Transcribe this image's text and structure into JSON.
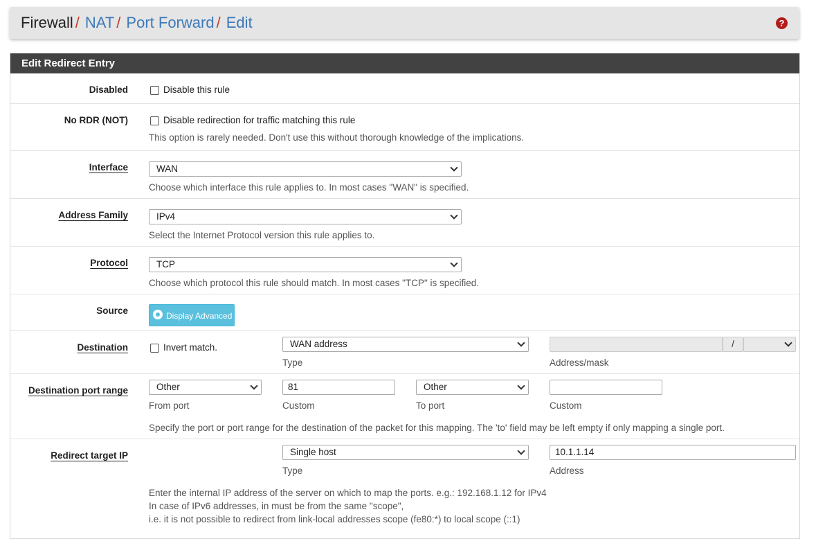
{
  "breadcrumb": {
    "items": [
      "Firewall",
      "NAT",
      "Port Forward",
      "Edit"
    ],
    "separator": "/"
  },
  "help_icon": "?",
  "panel": {
    "title": "Edit Redirect Entry"
  },
  "disabled": {
    "label": "Disabled",
    "checkbox_label": "Disable this rule",
    "checked": false
  },
  "nordr": {
    "label": "No RDR (NOT)",
    "checkbox_label": "Disable redirection for traffic matching this rule",
    "help": "This option is rarely needed. Don't use this without thorough knowledge of the implications.",
    "checked": false
  },
  "interface": {
    "label": "Interface",
    "value": "WAN",
    "help": "Choose which interface this rule applies to. In most cases \"WAN\" is specified."
  },
  "address_family": {
    "label": "Address Family",
    "value": "IPv4",
    "help": "Select the Internet Protocol version this rule applies to."
  },
  "protocol": {
    "label": "Protocol",
    "value": "TCP",
    "help": "Choose which protocol this rule should match. In most cases \"TCP\" is specified."
  },
  "source": {
    "label": "Source",
    "button_label": "Display Advanced"
  },
  "destination": {
    "label": "Destination",
    "invert_label": "Invert match.",
    "type_value": "WAN address",
    "type_caption": "Type",
    "address_value": "",
    "mask_separator": "/",
    "mask_value": "",
    "address_caption": "Address/mask"
  },
  "dest_port": {
    "label": "Destination port range",
    "from_value": "Other",
    "from_caption": "From port",
    "from_custom": "81",
    "from_custom_caption": "Custom",
    "to_value": "Other",
    "to_caption": "To port",
    "to_custom": "",
    "to_custom_caption": "Custom",
    "help": "Specify the port or port range for the destination of the packet for this mapping. The 'to' field may be left empty if only mapping a single port."
  },
  "redirect": {
    "label": "Redirect target IP",
    "type_value": "Single host",
    "type_caption": "Type",
    "address_value": "10.1.1.14",
    "address_caption": "Address",
    "help1": "Enter the internal IP address of the server on which to map the ports. e.g.: 192.168.1.12 for IPv4",
    "help2": "In case of IPv6 addresses, in must be from the same \"scope\",",
    "help3": "i.e. it is not possible to redirect from link-local addresses scope (fe80:*) to local scope (::1)"
  },
  "colors": {
    "header_bg": "#424242",
    "link": "#3d79b8",
    "separator": "#c23b2c",
    "info_button": "#5bc0de",
    "help_icon": "#b41c1c"
  }
}
